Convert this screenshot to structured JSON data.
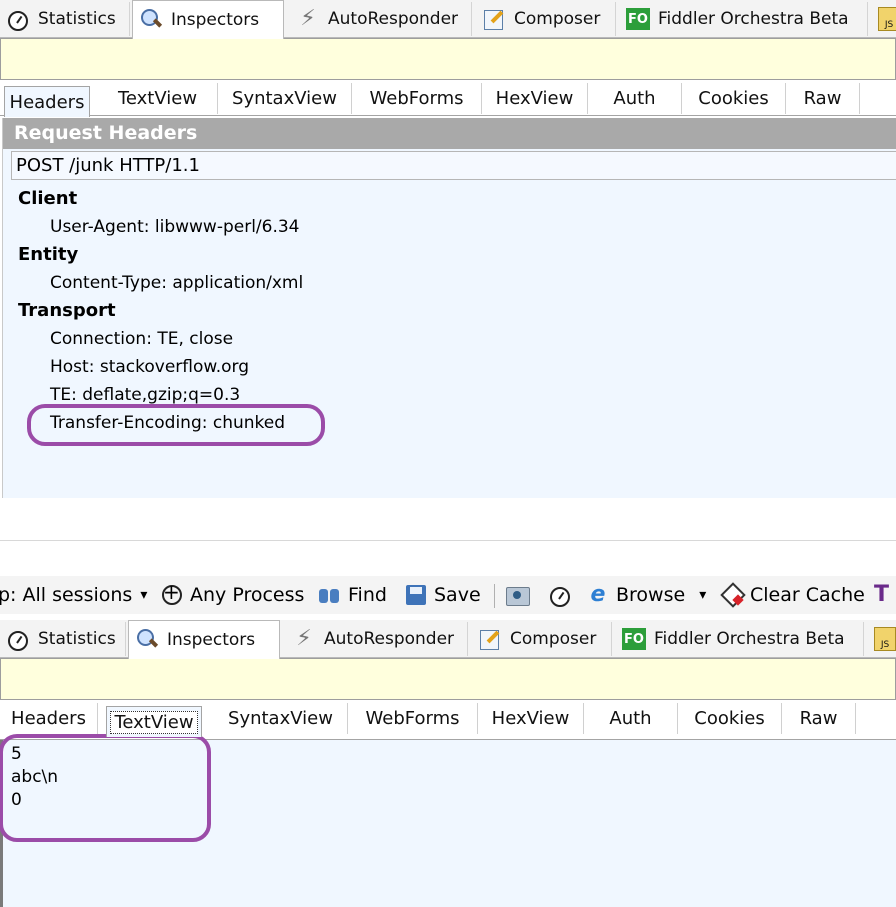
{
  "main_tabs": [
    {
      "label": "Statistics",
      "icon": "stopwatch-icon"
    },
    {
      "label": "Inspectors",
      "icon": "inspect-icon"
    },
    {
      "label": "AutoResponder",
      "icon": "lightning-icon"
    },
    {
      "label": "Composer",
      "icon": "composer-icon"
    },
    {
      "label": "Fiddler Orchestra Beta",
      "icon": "fo-icon"
    }
  ],
  "sub_tabs": [
    "Headers",
    "TextView",
    "SyntaxView",
    "WebForms",
    "HexView",
    "Auth",
    "Cookies",
    "Raw"
  ],
  "request_headers": {
    "title": "Request Headers",
    "request_line": "POST /junk HTTP/1.1",
    "groups": [
      {
        "name": "Client",
        "headers": [
          "User-Agent: libwww-perl/6.34"
        ]
      },
      {
        "name": "Entity",
        "headers": [
          "Content-Type: application/xml"
        ]
      },
      {
        "name": "Transport",
        "headers": [
          "Connection: TE, close",
          "Host: stackoverflow.org",
          "TE: deflate,gzip;q=0.3",
          "Transfer-Encoding: chunked"
        ]
      }
    ]
  },
  "toolbar": {
    "keep_label": "p: All sessions",
    "dropdown_glyph": "▾",
    "any_process": "Any Process",
    "find": "Find",
    "save": "Save",
    "browse": "Browse",
    "clear_cache": "Clear Cache"
  },
  "fo_badge": "FO",
  "js_badge": "JS",
  "t_glyph": "T",
  "text_view": {
    "lines": [
      "5",
      "abc\\n",
      "0"
    ]
  },
  "colors": {
    "highlight": "#9b4ca8",
    "view_bg": "#f0f7ff",
    "yellow_bar": "#ffffdd",
    "header_bar": "#a9a9a9"
  }
}
